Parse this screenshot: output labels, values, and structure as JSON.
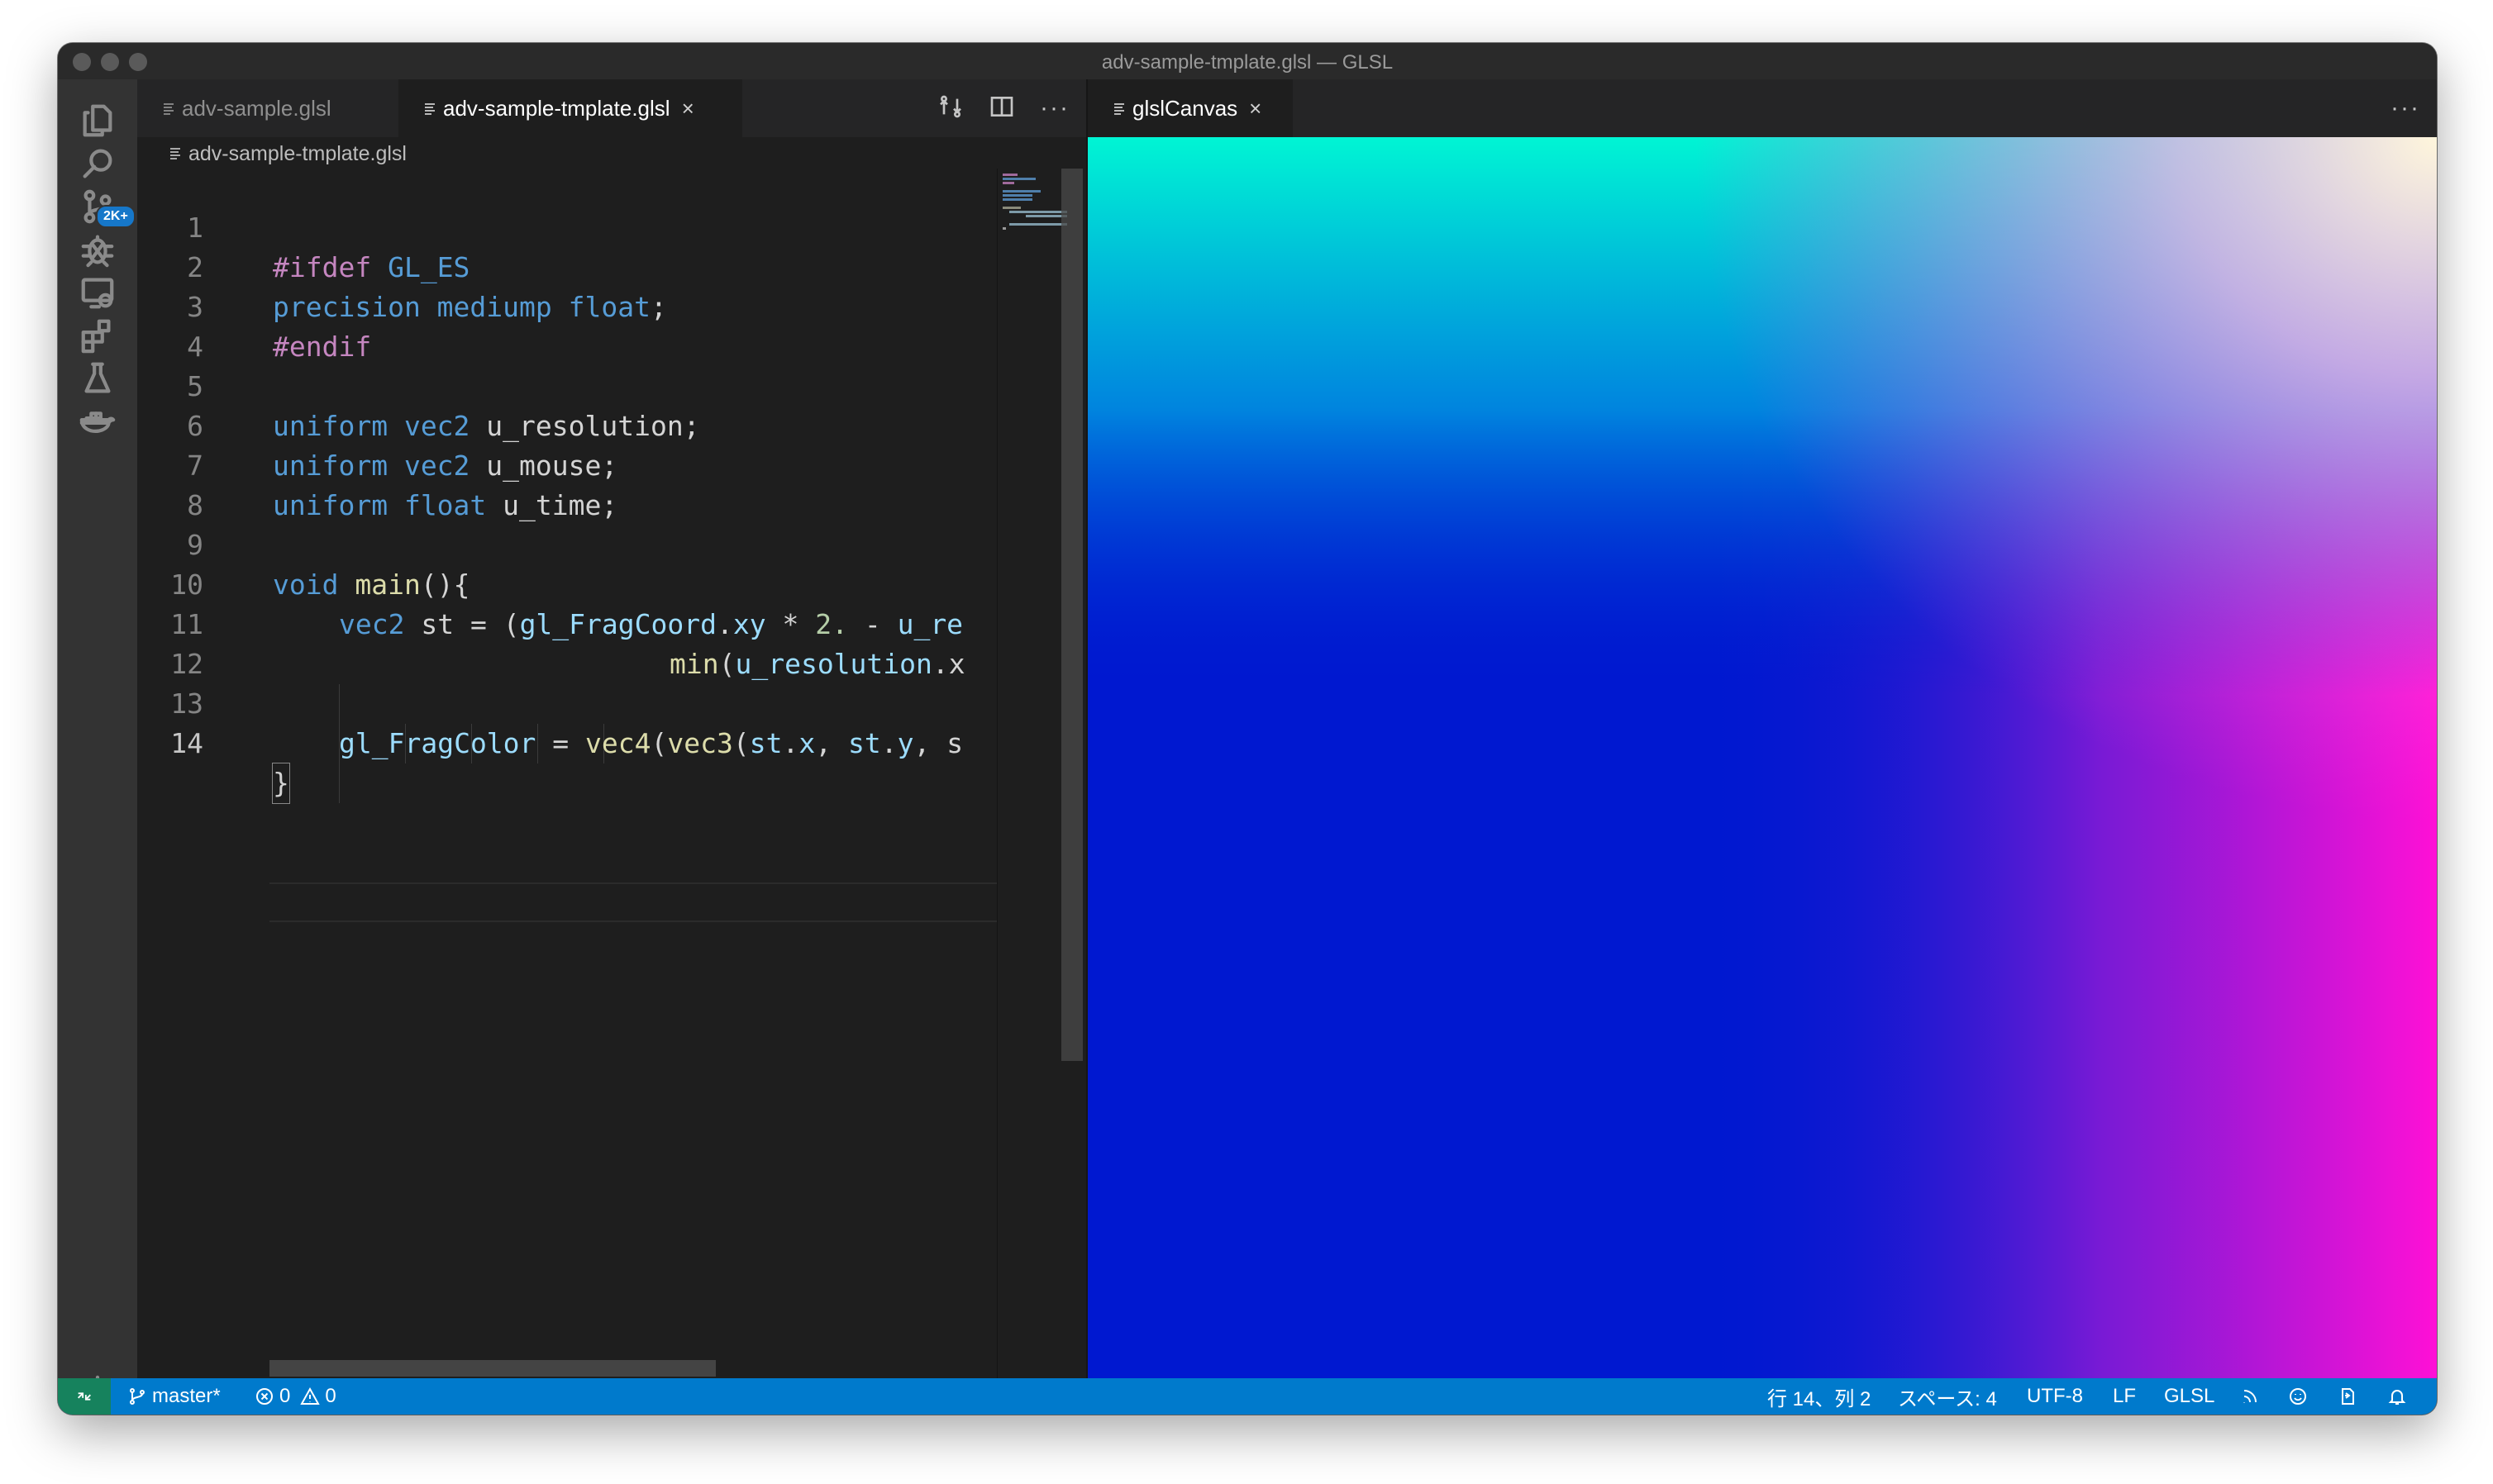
{
  "window": {
    "title": "adv-sample-tmplate.glsl — GLSL"
  },
  "activity_bar": {
    "scm_badge": "2K+"
  },
  "editor": {
    "tabs": [
      {
        "label": "adv-sample.glsl",
        "active": false
      },
      {
        "label": "adv-sample-tmplate.glsl",
        "active": true,
        "close": "×"
      }
    ],
    "actions_more": "···",
    "breadcrumb": "adv-sample-tmplate.glsl",
    "line_numbers": [
      "1",
      "2",
      "3",
      "4",
      "5",
      "6",
      "7",
      "8",
      "9",
      "10",
      "11",
      "12",
      "13",
      "14"
    ],
    "code": {
      "l1": {
        "kw": "#ifdef",
        "id": " GL_ES"
      },
      "l2": {
        "ty1": "precision",
        "ty2": " mediump",
        "ty3": " float",
        "p": ";"
      },
      "l3": {
        "kw": "#endif"
      },
      "l5": {
        "ty1": "uniform",
        "ty2": " vec2",
        "p": " u_resolution;"
      },
      "l6": {
        "ty1": "uniform",
        "ty2": " vec2",
        "p": " u_mouse;"
      },
      "l7": {
        "ty1": "uniform",
        "ty2": " float",
        "p": " u_time;"
      },
      "l9": {
        "ty": "void",
        "fn": " main",
        "p": "(){"
      },
      "l10": {
        "ty": "vec2",
        "p1": " st = (",
        "id1": "gl_FragCoord",
        "p2": ".",
        "id2": "xy",
        "p3": " * ",
        "nu": "2.",
        "p4": " - ",
        "id3": "u_re"
      },
      "l11": {
        "fn": "min",
        "p1": "(",
        "id1": "u_resolution",
        "p2": ".x"
      },
      "l13": {
        "id1": "gl_FragColor",
        "p1": " = ",
        "fn1": "vec4",
        "p2": "(",
        "fn2": "vec3",
        "p3": "(",
        "id2": "st",
        "p4": ".",
        "id3": "x",
        "p5": ", ",
        "id4": "st",
        "p6": ".",
        "id5": "y",
        "p7": ", s"
      },
      "l14": {
        "p": "}"
      }
    }
  },
  "preview": {
    "tab": {
      "label": "glslCanvas",
      "close": "×"
    },
    "more": "···"
  },
  "status_bar": {
    "branch": "master*",
    "errors": "0",
    "warnings": "0",
    "position": "行 14、列 2",
    "indent": "スペース: 4",
    "encoding": "UTF-8",
    "eol": "LF",
    "language": "GLSL"
  },
  "colors": {
    "status_bar": "#007acc",
    "remote": "#16825d",
    "badge": "#1677c9"
  }
}
